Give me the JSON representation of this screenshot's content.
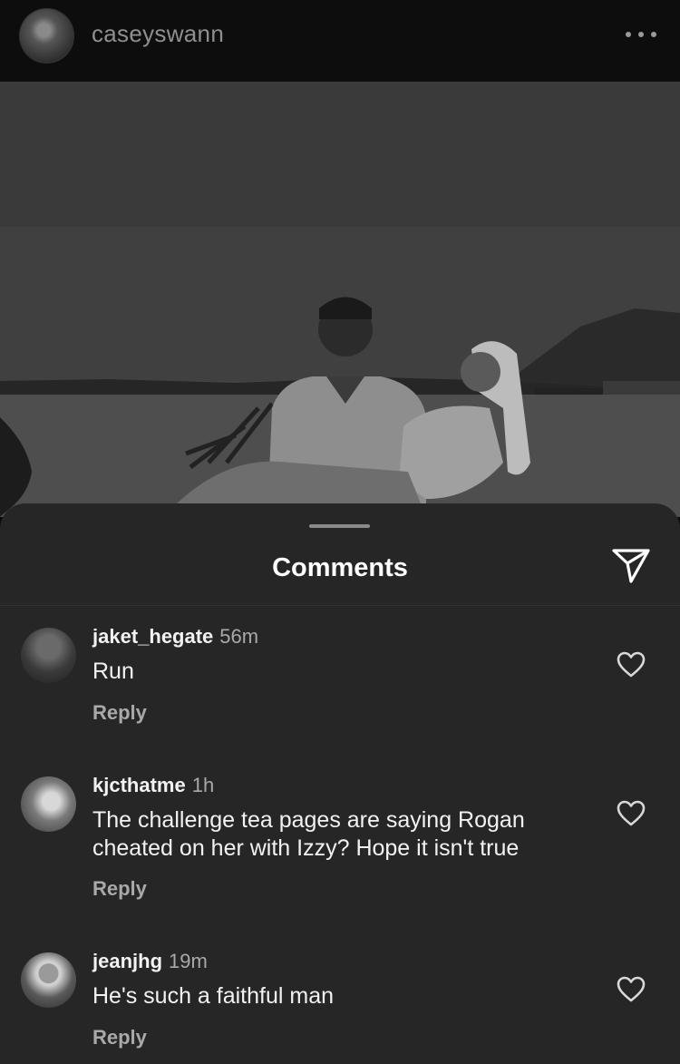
{
  "header": {
    "username": "caseyswann"
  },
  "sheet": {
    "title": "Comments"
  },
  "comments": [
    {
      "username": "jaket_hegate",
      "time": "56m",
      "text": "Run",
      "reply_label": "Reply"
    },
    {
      "username": "kjcthatme",
      "time": "1h",
      "text": "The challenge tea pages are saying Rogan cheated on her with Izzy? Hope it isn't true",
      "reply_label": "Reply"
    },
    {
      "username": "jeanjhg",
      "time": "19m",
      "text": "He's such a faithful man",
      "reply_label": "Reply"
    }
  ]
}
